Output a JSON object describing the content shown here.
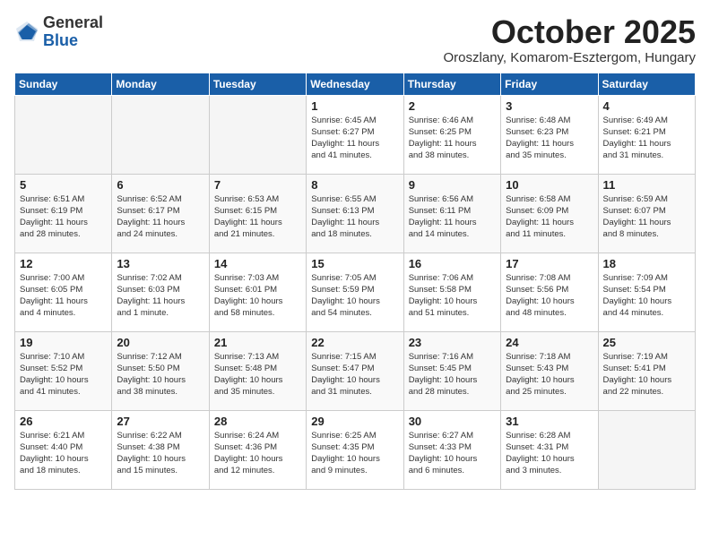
{
  "logo": {
    "general": "General",
    "blue": "Blue"
  },
  "header": {
    "month": "October 2025",
    "location": "Oroszlany, Komarom-Esztergom, Hungary"
  },
  "weekdays": [
    "Sunday",
    "Monday",
    "Tuesday",
    "Wednesday",
    "Thursday",
    "Friday",
    "Saturday"
  ],
  "weeks": [
    [
      {
        "day": "",
        "info": ""
      },
      {
        "day": "",
        "info": ""
      },
      {
        "day": "",
        "info": ""
      },
      {
        "day": "1",
        "info": "Sunrise: 6:45 AM\nSunset: 6:27 PM\nDaylight: 11 hours\nand 41 minutes."
      },
      {
        "day": "2",
        "info": "Sunrise: 6:46 AM\nSunset: 6:25 PM\nDaylight: 11 hours\nand 38 minutes."
      },
      {
        "day": "3",
        "info": "Sunrise: 6:48 AM\nSunset: 6:23 PM\nDaylight: 11 hours\nand 35 minutes."
      },
      {
        "day": "4",
        "info": "Sunrise: 6:49 AM\nSunset: 6:21 PM\nDaylight: 11 hours\nand 31 minutes."
      }
    ],
    [
      {
        "day": "5",
        "info": "Sunrise: 6:51 AM\nSunset: 6:19 PM\nDaylight: 11 hours\nand 28 minutes."
      },
      {
        "day": "6",
        "info": "Sunrise: 6:52 AM\nSunset: 6:17 PM\nDaylight: 11 hours\nand 24 minutes."
      },
      {
        "day": "7",
        "info": "Sunrise: 6:53 AM\nSunset: 6:15 PM\nDaylight: 11 hours\nand 21 minutes."
      },
      {
        "day": "8",
        "info": "Sunrise: 6:55 AM\nSunset: 6:13 PM\nDaylight: 11 hours\nand 18 minutes."
      },
      {
        "day": "9",
        "info": "Sunrise: 6:56 AM\nSunset: 6:11 PM\nDaylight: 11 hours\nand 14 minutes."
      },
      {
        "day": "10",
        "info": "Sunrise: 6:58 AM\nSunset: 6:09 PM\nDaylight: 11 hours\nand 11 minutes."
      },
      {
        "day": "11",
        "info": "Sunrise: 6:59 AM\nSunset: 6:07 PM\nDaylight: 11 hours\nand 8 minutes."
      }
    ],
    [
      {
        "day": "12",
        "info": "Sunrise: 7:00 AM\nSunset: 6:05 PM\nDaylight: 11 hours\nand 4 minutes."
      },
      {
        "day": "13",
        "info": "Sunrise: 7:02 AM\nSunset: 6:03 PM\nDaylight: 11 hours\nand 1 minute."
      },
      {
        "day": "14",
        "info": "Sunrise: 7:03 AM\nSunset: 6:01 PM\nDaylight: 10 hours\nand 58 minutes."
      },
      {
        "day": "15",
        "info": "Sunrise: 7:05 AM\nSunset: 5:59 PM\nDaylight: 10 hours\nand 54 minutes."
      },
      {
        "day": "16",
        "info": "Sunrise: 7:06 AM\nSunset: 5:58 PM\nDaylight: 10 hours\nand 51 minutes."
      },
      {
        "day": "17",
        "info": "Sunrise: 7:08 AM\nSunset: 5:56 PM\nDaylight: 10 hours\nand 48 minutes."
      },
      {
        "day": "18",
        "info": "Sunrise: 7:09 AM\nSunset: 5:54 PM\nDaylight: 10 hours\nand 44 minutes."
      }
    ],
    [
      {
        "day": "19",
        "info": "Sunrise: 7:10 AM\nSunset: 5:52 PM\nDaylight: 10 hours\nand 41 minutes."
      },
      {
        "day": "20",
        "info": "Sunrise: 7:12 AM\nSunset: 5:50 PM\nDaylight: 10 hours\nand 38 minutes."
      },
      {
        "day": "21",
        "info": "Sunrise: 7:13 AM\nSunset: 5:48 PM\nDaylight: 10 hours\nand 35 minutes."
      },
      {
        "day": "22",
        "info": "Sunrise: 7:15 AM\nSunset: 5:47 PM\nDaylight: 10 hours\nand 31 minutes."
      },
      {
        "day": "23",
        "info": "Sunrise: 7:16 AM\nSunset: 5:45 PM\nDaylight: 10 hours\nand 28 minutes."
      },
      {
        "day": "24",
        "info": "Sunrise: 7:18 AM\nSunset: 5:43 PM\nDaylight: 10 hours\nand 25 minutes."
      },
      {
        "day": "25",
        "info": "Sunrise: 7:19 AM\nSunset: 5:41 PM\nDaylight: 10 hours\nand 22 minutes."
      }
    ],
    [
      {
        "day": "26",
        "info": "Sunrise: 6:21 AM\nSunset: 4:40 PM\nDaylight: 10 hours\nand 18 minutes."
      },
      {
        "day": "27",
        "info": "Sunrise: 6:22 AM\nSunset: 4:38 PM\nDaylight: 10 hours\nand 15 minutes."
      },
      {
        "day": "28",
        "info": "Sunrise: 6:24 AM\nSunset: 4:36 PM\nDaylight: 10 hours\nand 12 minutes."
      },
      {
        "day": "29",
        "info": "Sunrise: 6:25 AM\nSunset: 4:35 PM\nDaylight: 10 hours\nand 9 minutes."
      },
      {
        "day": "30",
        "info": "Sunrise: 6:27 AM\nSunset: 4:33 PM\nDaylight: 10 hours\nand 6 minutes."
      },
      {
        "day": "31",
        "info": "Sunrise: 6:28 AM\nSunset: 4:31 PM\nDaylight: 10 hours\nand 3 minutes."
      },
      {
        "day": "",
        "info": ""
      }
    ]
  ]
}
